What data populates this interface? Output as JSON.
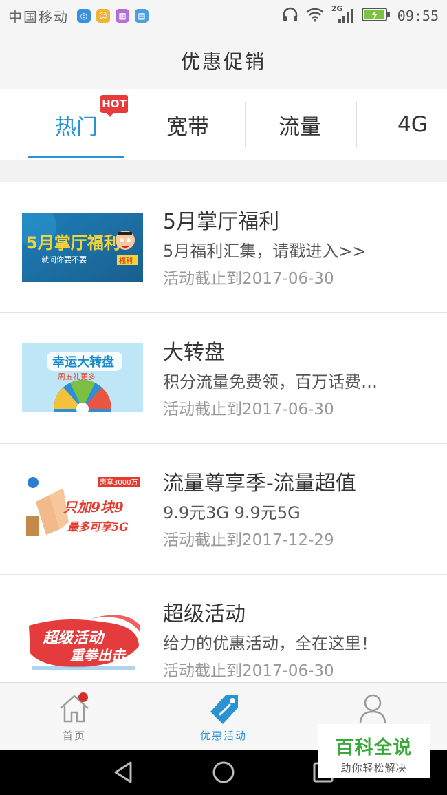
{
  "status_bar": {
    "carrier": "中国移动",
    "network": "2G",
    "time": "09:55"
  },
  "header": {
    "title": "优惠促销"
  },
  "tabs": {
    "items": [
      {
        "label": "热门",
        "active": true
      },
      {
        "label": "宽带",
        "active": false
      },
      {
        "label": "流量",
        "active": false
      },
      {
        "label": "4G",
        "active": false
      }
    ],
    "badge": "HOT"
  },
  "promotions": [
    {
      "title": "5月掌厅福利",
      "desc": "5月福利汇集，请戳进入>>",
      "date": "活动截止到2017-06-30",
      "banner": {
        "line1": "5月掌厅福利",
        "line2": "就问你要不要",
        "tag": "福利"
      }
    },
    {
      "title": "大转盘",
      "desc": "积分流量免费领，百万话费…",
      "date": "活动截止到2017-06-30",
      "banner": {
        "line1": "幸运大转盘",
        "line2": "周五礼更多"
      }
    },
    {
      "title": "流量尊享季-流量超值",
      "desc": "9.9元3G 9.9元5G",
      "date": "活动截止到2017-12-29",
      "banner": {
        "badge": "惠享3000万",
        "line1": "只加9块9",
        "line2": "最多可享5G"
      }
    },
    {
      "title": "超级活动",
      "desc": "给力的优惠活动，全在这里！",
      "date": "活动截止到2017-06-30",
      "banner": {
        "line1": "超级活动",
        "line2": "重拳出击"
      }
    }
  ],
  "bottom_nav": {
    "items": [
      {
        "label": "首页",
        "active": false,
        "icon": "home-icon"
      },
      {
        "label": "优惠活动",
        "active": true,
        "icon": "tag-icon"
      },
      {
        "label": "",
        "active": false,
        "icon": "user-icon"
      }
    ]
  },
  "watermark": {
    "main": "百科全说",
    "sub": "助你轻松解决"
  },
  "colors": {
    "accent": "#2a93d4",
    "hot": "#e73a3a",
    "watermark": "#3aa83a"
  }
}
